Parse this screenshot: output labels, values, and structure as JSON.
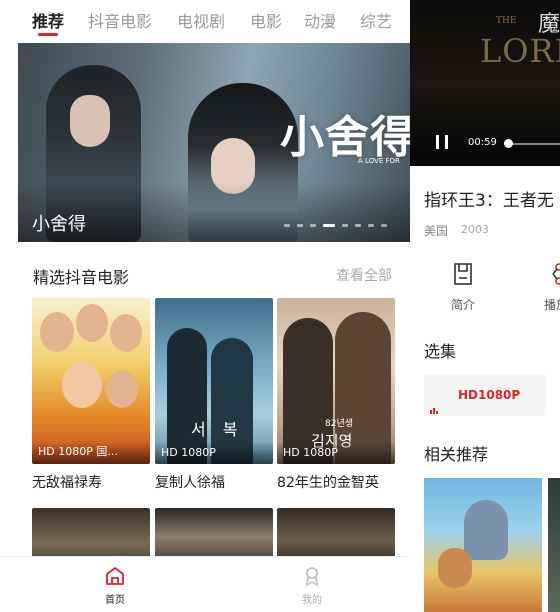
{
  "home": {
    "tabs": [
      "推荐",
      "抖音电影",
      "电视剧",
      "电影",
      "动漫",
      "综艺"
    ],
    "active_tab": 0,
    "banner": {
      "art_title": "小舍得",
      "art_subtitle": "A LOVE FOR",
      "caption": "小舍得",
      "slide_count": 8,
      "active_slide": 3
    },
    "section": {
      "title": "精选抖音电影",
      "more": "查看全部"
    },
    "movies": [
      {
        "title": "无敌福禄寿",
        "quality": "HD 1080P 国..."
      },
      {
        "title": "复制人徐福",
        "quality": "HD 1080P",
        "art": "서 복"
      },
      {
        "title": "82年生的金智英",
        "quality": "HD 1080P",
        "art": "김지영",
        "art_top": "82년생"
      }
    ],
    "nav": [
      {
        "label": "首页",
        "icon": "home-icon",
        "active": true
      },
      {
        "label": "我的",
        "icon": "profile-icon",
        "active": false
      }
    ]
  },
  "detail": {
    "video": {
      "art_the": "THE",
      "art_title": "LORD",
      "art_cjk": "魔",
      "time": "00:59",
      "progress": 0.05
    },
    "title": "指环王3：王者无",
    "country": "美国",
    "year": "2003",
    "actions": [
      {
        "label": "简介",
        "icon": "document-icon"
      },
      {
        "label": "播放",
        "icon": "share-icon"
      }
    ],
    "episodes_title": "选集",
    "episode": "HD1080P",
    "related_title": "相关推荐"
  },
  "colors": {
    "accent": "#d9252a",
    "tab_inactive": "#999999",
    "nav_inactive": "#aaaaaa"
  }
}
